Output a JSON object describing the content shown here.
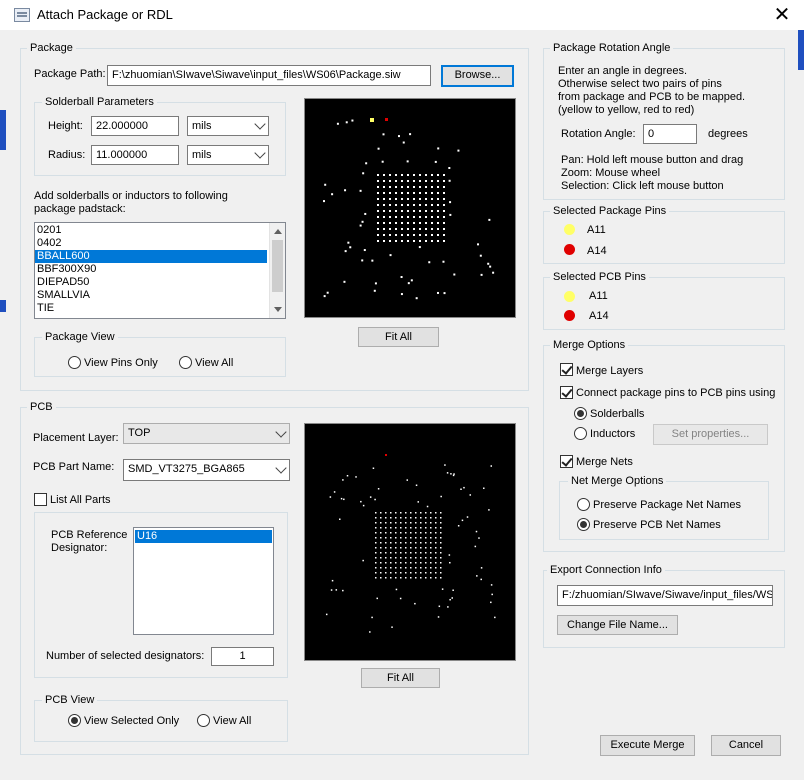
{
  "window": {
    "title": "Attach Package or RDL"
  },
  "package": {
    "group_label": "Package",
    "path_label": "Package Path:",
    "path_value": "F:\\zhuomian\\SIwave\\Siwave\\input_files\\WS06\\Package.siw",
    "browse_button": "Browse...",
    "solderball_group": "Solderball Parameters",
    "height_label": "Height:",
    "height_value": "22.000000",
    "height_unit": "mils",
    "radius_label": "Radius:",
    "radius_value": "11.000000",
    "radius_unit": "mils",
    "padstack_label_line1": "Add solderballs or inductors to following",
    "padstack_label_line2": "package padstack:",
    "padstacks": [
      "0201",
      "0402",
      "BBALL600",
      "BBF300X90",
      "DIEPAD50",
      "SMALLVIA",
      "TIE"
    ],
    "selected_padstack": "BBALL600",
    "fit_all": "Fit All",
    "view_group": "Package View",
    "view_pins_only": "View Pins Only",
    "view_all": "View All"
  },
  "pcb": {
    "group_label": "PCB",
    "placement_label": "Placement Layer:",
    "placement_value": "TOP",
    "part_label": "PCB Part Name:",
    "part_value": "SMD_VT3275_BGA865",
    "list_all_parts": "List All Parts",
    "ref_des_line1": "PCB Reference",
    "ref_des_line2": "Designator:",
    "designators": [
      "U16"
    ],
    "num_selected_label": "Number of selected designators:",
    "num_selected_value": "1",
    "fit_all": "Fit All",
    "view_group": "PCB View",
    "view_selected_only": "View Selected Only",
    "view_all": "View All"
  },
  "rotation": {
    "group_label": "Package Rotation Angle",
    "instr_line1": "Enter an angle in degrees.",
    "instr_line2": "Otherwise select two pairs of pins",
    "instr_line3": "from package and PCB to be mapped.",
    "instr_line4": "(yellow to yellow, red to red)",
    "angle_label": "Rotation Angle:",
    "angle_value": "0",
    "angle_unit": "degrees",
    "help_line1": "Pan: Hold left mouse button and drag",
    "help_line2": "Zoom: Mouse wheel",
    "help_line3": "Selection: Click left mouse button"
  },
  "selected_package_pins": {
    "group_label": "Selected Package Pins",
    "pin_yellow": "A11",
    "pin_red": "A14"
  },
  "selected_pcb_pins": {
    "group_label": "Selected PCB Pins",
    "pin_yellow": "A11",
    "pin_red": "A14"
  },
  "merge": {
    "group_label": "Merge Options",
    "merge_layers": "Merge Layers",
    "connect_pins": "Connect package pins to PCB pins using",
    "solderballs": "Solderballs",
    "inductors": "Inductors",
    "set_properties": "Set properties...",
    "merge_nets": "Merge Nets",
    "net_merge_group": "Net Merge Options",
    "preserve_package": "Preserve Package Net Names",
    "preserve_pcb": "Preserve PCB Net Names"
  },
  "export": {
    "group_label": "Export Connection Info",
    "path_value": "F:/zhuomian/SIwave/Siwave/input_files/WS",
    "change_button": "Change File Name..."
  },
  "footer": {
    "execute": "Execute Merge",
    "cancel": "Cancel"
  },
  "colors": {
    "pin_yellow": "#ffff66",
    "pin_red": "#e00000",
    "selection": "#0078d7"
  }
}
